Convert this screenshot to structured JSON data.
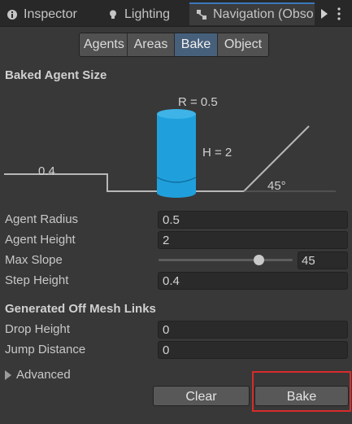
{
  "tabs": [
    {
      "label": "Inspector",
      "icon": "info-icon"
    },
    {
      "label": "Lighting",
      "icon": "bulb-icon"
    },
    {
      "label": "Navigation (Obso",
      "icon": "navigation-icon",
      "active": true
    }
  ],
  "subtabs": {
    "items": [
      "Agents",
      "Areas",
      "Bake",
      "Object"
    ],
    "selected": "Bake"
  },
  "baked_agent_size": {
    "heading": "Baked Agent Size",
    "diagram": {
      "radius_label": "R = 0.5",
      "height_label": "H = 2",
      "step_label": "0.4",
      "slope_label": "45°"
    }
  },
  "fields": {
    "agent_radius": {
      "label": "Agent Radius",
      "value": "0.5"
    },
    "agent_height": {
      "label": "Agent Height",
      "value": "2"
    },
    "max_slope": {
      "label": "Max Slope",
      "value": "45",
      "slider_fraction": 0.75
    },
    "step_height": {
      "label": "Step Height",
      "value": "0.4"
    }
  },
  "off_mesh": {
    "heading": "Generated Off Mesh Links",
    "drop_height": {
      "label": "Drop Height",
      "value": "0"
    },
    "jump_distance": {
      "label": "Jump Distance",
      "value": "0"
    }
  },
  "advanced_label": "Advanced",
  "buttons": {
    "clear": "Clear",
    "bake": "Bake"
  },
  "colors": {
    "cylinder": "#1fa0dc",
    "selected_tab": "#46607c",
    "highlight": "#d82b2b"
  }
}
